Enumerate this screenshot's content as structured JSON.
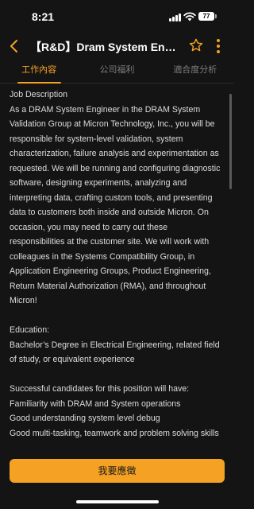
{
  "status_bar": {
    "time": "8:21",
    "battery": "77"
  },
  "header": {
    "title": "【R&D】Dram System Engineer",
    "back_icon": "chevron-left-icon",
    "favorite_icon": "star-outline-icon",
    "more_icon": "more-vertical-icon"
  },
  "tabs": [
    {
      "label": "工作內容",
      "active": true
    },
    {
      "label": "公司福利",
      "active": false
    },
    {
      "label": "適合度分析",
      "active": false
    }
  ],
  "content": {
    "heading": "Job Description",
    "description": "As a DRAM System Engineer in the DRAM System Validation Group at Micron Technology, Inc., you will be responsible for system-level validation, system characterization, failure analysis and experimentation as requested. We will be running and configuring diagnostic software, designing experiments, analyzing and interpreting data, crafting custom tools, and presenting data to customers both inside and outside Micron. On occasion, you may need to carry out these responsibilities at the customer site. We will work with colleagues in the Systems Compatibility Group, in Application Engineering Groups, Product Engineering, Return Material Authorization (RMA), and throughout Micron!",
    "education_heading": "Education:",
    "education_text": "Bachelor’s Degree in Electrical Engineering, related field of study, or equivalent experience",
    "candidates_heading": "Successful candidates for this position will have:",
    "requirements": [
      "Familiarity with DRAM and System operations",
      "Good understanding system level debug",
      "Good multi-tasking, teamwork and problem solving skills"
    ]
  },
  "apply_button": {
    "label": "我要應徵"
  },
  "colors": {
    "accent": "#f5a123",
    "background": "#141414"
  }
}
